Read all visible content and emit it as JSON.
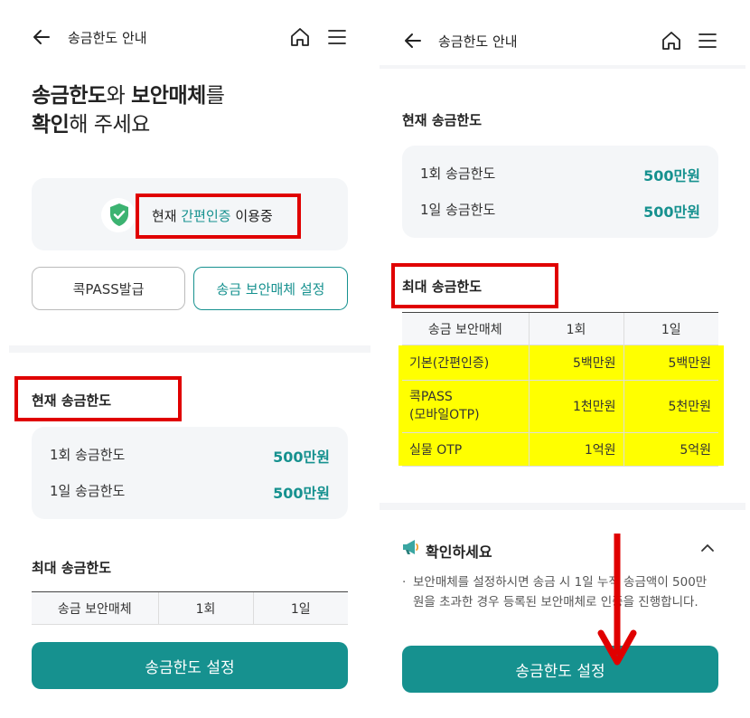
{
  "header": {
    "title": "송금한도 안내"
  },
  "left": {
    "headline": {
      "bold1": "송금한도",
      "plain1": "와 ",
      "bold2": "보안매체",
      "plain2": "를",
      "bold3": "확인",
      "plain3": "해 주세요"
    },
    "auth": {
      "prefix": "현재 ",
      "method": "간편인증",
      "suffix": " 이용중"
    },
    "buttons": {
      "pass_issue": "콕PASS발급",
      "security_setting": "송금 보안매체 설정"
    },
    "current_limit": {
      "title": "현재 송금한도",
      "rows": [
        {
          "label": "1회 송금한도",
          "value": "500만원"
        },
        {
          "label": "1일 송금한도",
          "value": "500만원"
        }
      ]
    },
    "max_limit": {
      "title": "최대 송금한도",
      "headers": [
        "송금 보안매체",
        "1회",
        "1일"
      ]
    },
    "cta": "송금한도 설정"
  },
  "right": {
    "current_limit": {
      "title": "현재 송금한도",
      "rows": [
        {
          "label": "1회 송금한도",
          "value": "500만원"
        },
        {
          "label": "1일 송금한도",
          "value": "500만원"
        }
      ]
    },
    "max_limit": {
      "title": "최대 송금한도",
      "headers": [
        "송금 보안매체",
        "1회",
        "1일"
      ],
      "rows": [
        {
          "media": "기본(간편인증)",
          "once": "5백만원",
          "daily": "5백만원"
        },
        {
          "media": "콕PASS\n(모바일OTP)",
          "once": "1천만원",
          "daily": "5천만원"
        },
        {
          "media": "실물 OTP",
          "once": "1억원",
          "daily": "5억원"
        }
      ]
    },
    "notice": {
      "title": "확인하세요",
      "body": "보안매체를 설정하시면 송금 시 1일 누적 송금액이 500만원을 초과한 경우 등록된 보안매체로 인증을 진행합니다."
    },
    "cta": "송금한도 설정"
  },
  "colors": {
    "accent": "#16918f",
    "highlight": "#ffff00",
    "annotation": "#e00000"
  }
}
